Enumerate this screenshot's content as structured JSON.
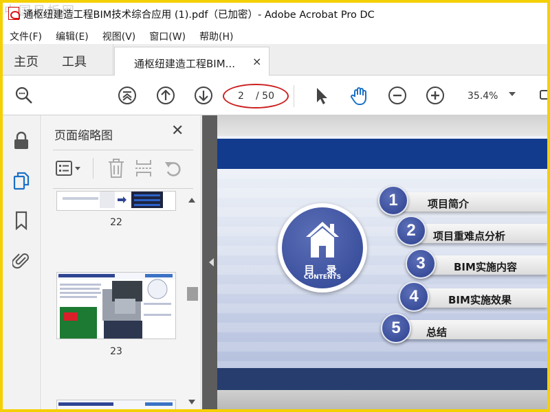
{
  "window": {
    "title": "通枢纽建造工程BIM技术综合应用 (1).pdf（已加密）- Adobe Acrobat Pro DC",
    "watermark": "中国风板网"
  },
  "menu": [
    "文件(F)",
    "编辑(E)",
    "视图(V)",
    "窗口(W)",
    "帮助(H)"
  ],
  "tabs": {
    "home": "主页",
    "tools": "工具",
    "document": "通枢纽建造工程BIM...",
    "close": "×"
  },
  "toolbar": {
    "current_page": "2",
    "total_pages": "/ 50",
    "zoom": "35.4%",
    "icons": [
      "search-zoom-icon",
      "first-page-icon",
      "previous-page-icon",
      "next-page-icon",
      "select-cursor-icon",
      "hand-tool-icon",
      "zoom-out-icon",
      "zoom-in-icon"
    ]
  },
  "sidebar_rail": {
    "icons": [
      "lock-icon",
      "page-thumbnails-icon",
      "bookmark-icon",
      "attachment-icon"
    ]
  },
  "thumbnails": {
    "title": "页面缩略图",
    "close": "✕",
    "pages": [
      {
        "label": "22"
      },
      {
        "label": "23"
      }
    ]
  },
  "slide": {
    "circle_title": "目 录",
    "circle_subtitle": "CONTENTS",
    "items": [
      {
        "number": "1",
        "label": "项目简介"
      },
      {
        "number": "2",
        "label": "项目重难点分析"
      },
      {
        "number": "3",
        "label": "BIM实施内容"
      },
      {
        "number": "4",
        "label": "BIM实施效果"
      },
      {
        "number": "5",
        "label": "总结"
      }
    ]
  },
  "colors": {
    "frame": "#f4d000",
    "slide_band": "#123b8e",
    "badge": "#2f4593",
    "annotation": "#cc1f1f",
    "hand_tool": "#1a6fc7"
  }
}
